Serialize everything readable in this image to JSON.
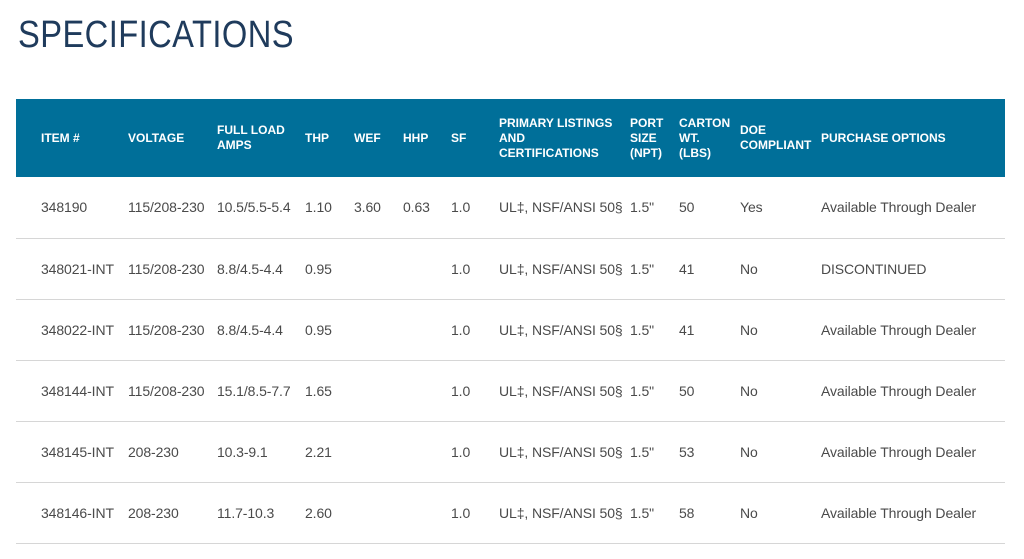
{
  "title": "SPECIFICATIONS",
  "table": {
    "headers": [
      [
        "ITEM #"
      ],
      [
        "VOLTAGE"
      ],
      [
        "FULL LOAD",
        "AMPS"
      ],
      [
        "THP"
      ],
      [
        "WEF"
      ],
      [
        "HHP"
      ],
      [
        "SF"
      ],
      [
        "PRIMARY LISTINGS",
        "AND",
        "CERTIFICATIONS"
      ],
      [
        "PORT",
        "SIZE",
        "(NPT)"
      ],
      [
        "CARTON",
        "WT.",
        "(LBS)"
      ],
      [
        "DOE",
        "COMPLIANT"
      ],
      [
        "PURCHASE OPTIONS"
      ]
    ],
    "rows": [
      [
        "348190",
        "115/208-230",
        "10.5/5.5-5.4",
        "1.10",
        "3.60",
        "0.63",
        "1.0",
        "UL‡, NSF/ANSI 50§",
        "1.5\"",
        "50",
        "Yes",
        "Available Through Dealer"
      ],
      [
        "348021-INT",
        "115/208-230",
        "8.8/4.5-4.4",
        "0.95",
        "",
        "",
        "1.0",
        "UL‡, NSF/ANSI 50§",
        "1.5\"",
        "41",
        "No",
        "DISCONTINUED"
      ],
      [
        "348022-INT",
        "115/208-230",
        "8.8/4.5-4.4",
        "0.95",
        "",
        "",
        "1.0",
        "UL‡, NSF/ANSI 50§",
        "1.5\"",
        "41",
        "No",
        "Available Through Dealer"
      ],
      [
        "348144-INT",
        "115/208-230",
        "15.1/8.5-7.7",
        "1.65",
        "",
        "",
        "1.0",
        "UL‡, NSF/ANSI 50§",
        "1.5\"",
        "50",
        "No",
        "Available Through Dealer"
      ],
      [
        "348145-INT",
        "208-230",
        "10.3-9.1",
        "2.21",
        "",
        "",
        "1.0",
        "UL‡, NSF/ANSI 50§",
        "1.5\"",
        "53",
        "No",
        "Available Through Dealer"
      ],
      [
        "348146-INT",
        "208-230",
        "11.7-10.3",
        "2.60",
        "",
        "",
        "1.0",
        "UL‡, NSF/ANSI 50§",
        "1.5\"",
        "58",
        "No",
        "Available Through Dealer"
      ]
    ]
  },
  "colors": {
    "header_bg": "#006f99",
    "title": "#1f3b5c"
  }
}
